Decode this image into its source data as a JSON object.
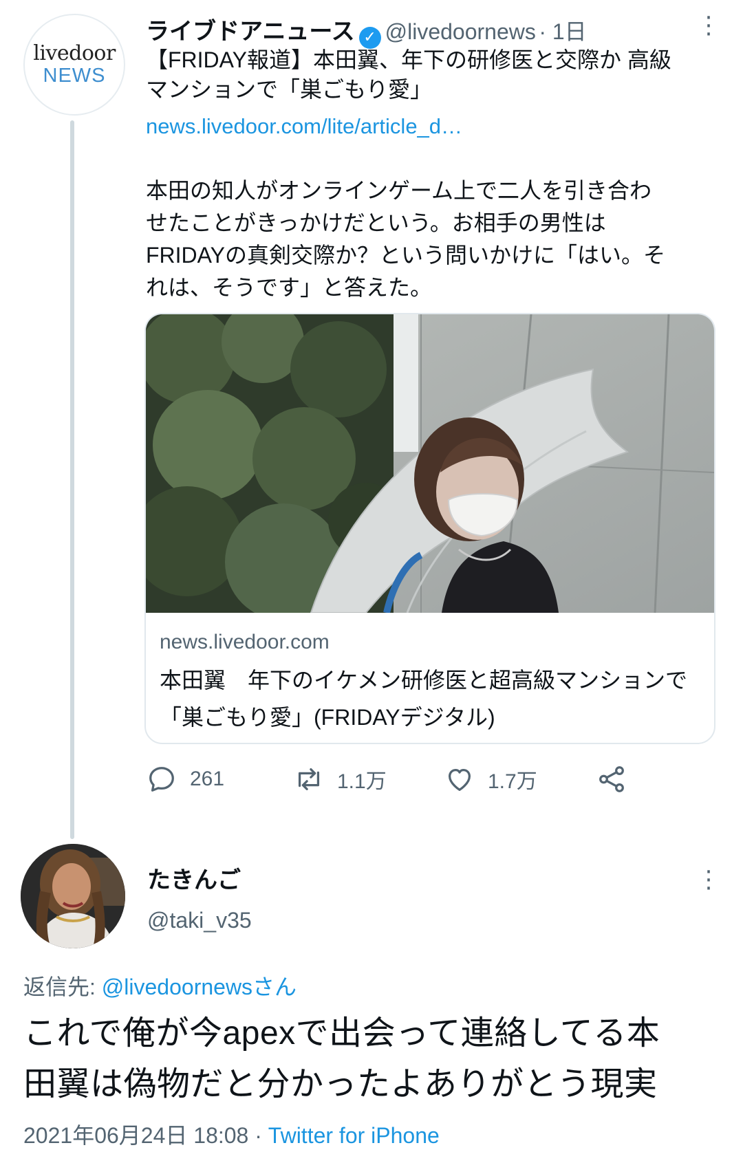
{
  "tweet": {
    "author": {
      "display_name": "ライブドアニュース",
      "handle": "@livedoornews",
      "time": "· 1日",
      "avatar_line1": "livedoor",
      "avatar_line2": "NEWS"
    },
    "headline_line1": "【FRIDAY報道】本田翼、年下の研修医と交際か 高級",
    "headline_line2": "マンションで「巣ごもり愛」",
    "link": "news.livedoor.com/lite/article_d…",
    "body_lines": [
      "本田の知人がオンラインゲーム上で二人を引き合わ",
      "せたことがきっかけだという。お相手の男性は",
      "FRIDAYの真剣交際か？という問いかけに「はい。そ",
      "れは、そうです」と答えた。"
    ],
    "card": {
      "domain": "news.livedoor.com",
      "title": "本田翼　年下のイケメン研修医と超高級マンションで「巣ごもり愛」(FRIDAYデジタル)"
    },
    "actions": {
      "replies": "261",
      "retweets": "1.1万",
      "likes": "1.7万"
    }
  },
  "reply": {
    "display_name": "たきんご",
    "handle": "@taki_v35",
    "reply_to_prefix": "返信先: ",
    "reply_to_handle": "@livedoornewsさん",
    "text_line1": "これで俺が今apexで出会って連絡してる本",
    "text_line2": "田翼は偽物だと分かったよありがとう現実",
    "timestamp": "2021年06月24日 18:08",
    "separator": " · ",
    "client": "Twitter for iPhone"
  },
  "icons": {
    "reply": "speech-bubble-icon",
    "retweet": "retweet-icon",
    "like": "heart-icon",
    "share": "share-icon",
    "verified": "verified-badge-icon",
    "more": "more-vertical-icon"
  },
  "colors": {
    "link": "#1b95e0",
    "verified": "#1d9bf0",
    "secondary_text": "#536471",
    "thread_line": "#cfd9de"
  }
}
